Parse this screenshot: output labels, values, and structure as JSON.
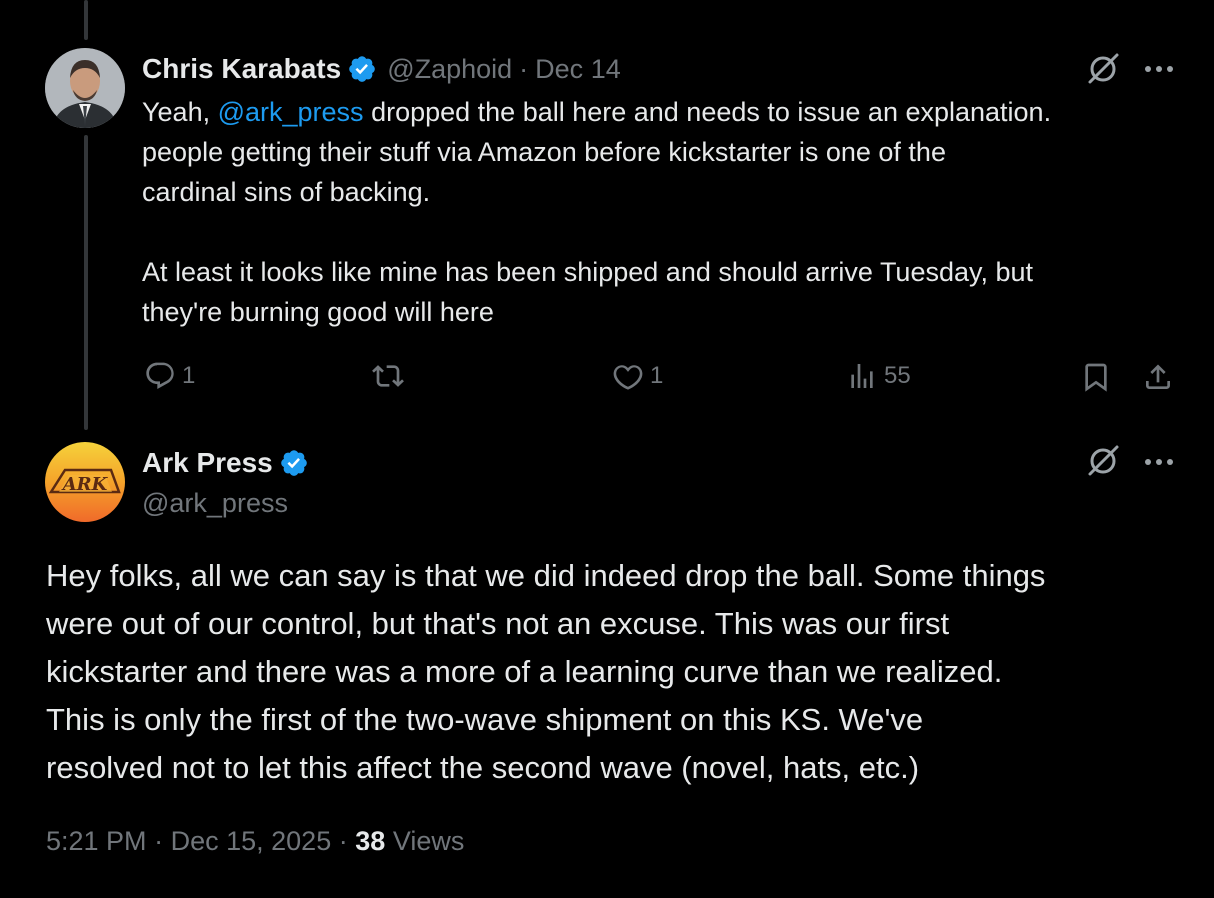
{
  "reply": {
    "author_name": "Chris Karabats",
    "handle": "@Zaphoid",
    "separator": "·",
    "date": "Dec 14",
    "text_prefix": "Yeah, ",
    "mention": "@ark_press",
    "text_line1_rest": " dropped the ball here and needs to issue an explanation.",
    "text_line2": "people getting their stuff via Amazon before kickstarter is one of the",
    "text_line3": "cardinal sins of backing.",
    "text_line4": "At least it looks like mine has been shipped and should arrive Tuesday, but",
    "text_line5": "they're burning good will here",
    "actions": {
      "reply_count": "1",
      "repost_count": "",
      "like_count": "1",
      "views_count": "55"
    }
  },
  "main_post": {
    "author_name": "Ark Press",
    "handle": "@ark_press",
    "avatar_text": "ARK",
    "text_line1": "Hey folks, all we can say is that we did indeed drop the ball. Some things",
    "text_line2": "were out of our control, but that's not an excuse. This was our first",
    "text_line3": "kickstarter and there was a more of a learning curve than we realized.",
    "text_line4": "This is only the first of the two-wave shipment on this KS. We've",
    "text_line5": "resolved not to let this affect the second wave (novel, hats, etc.)",
    "time": "5:21 PM",
    "separator": "·",
    "date": "Dec 15, 2025",
    "views_count": "38",
    "views_label": "Views"
  },
  "icons": {
    "grok": "grok-icon",
    "more": "more-icon",
    "verified": "verified-badge-icon",
    "reply": "reply-icon",
    "repost": "repost-icon",
    "like": "heart-icon",
    "views": "views-icon",
    "bookmark": "bookmark-icon",
    "share": "share-icon"
  },
  "colors": {
    "background": "#000000",
    "text": "#e7e9ea",
    "muted": "#71767b",
    "link": "#1d9bf0",
    "verified": "#1d9bf0"
  }
}
